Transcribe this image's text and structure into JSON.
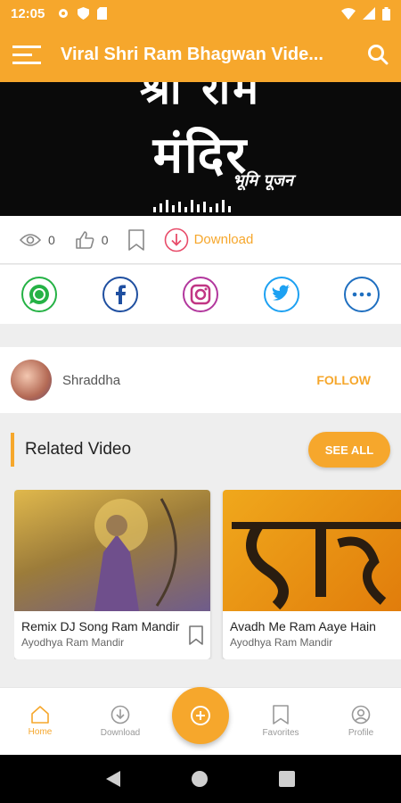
{
  "status": {
    "time": "12:05"
  },
  "appbar": {
    "title": "Viral Shri Ram Bhagwan Vide..."
  },
  "banner": {
    "line1": "श्री राम",
    "line2": "मंदिर",
    "line3": "भूमि पूजन"
  },
  "actions": {
    "views": "0",
    "likes": "0",
    "download": "Download"
  },
  "author": {
    "name": "Shraddha",
    "follow": "FOLLOW"
  },
  "related": {
    "title": "Related Video",
    "see_all": "SEE ALL"
  },
  "videos": [
    {
      "title": "Remix DJ Song Ram Mandir",
      "subtitle": "Ayodhya Ram Mandir"
    },
    {
      "title": "Avadh Me Ram Aaye Hain",
      "subtitle": "Ayodhya Ram Mandir"
    }
  ],
  "nav": {
    "home": "Home",
    "download": "Download",
    "favorites": "Favorites",
    "profile": "Profile"
  },
  "colors": {
    "accent": "#f6a72c"
  }
}
